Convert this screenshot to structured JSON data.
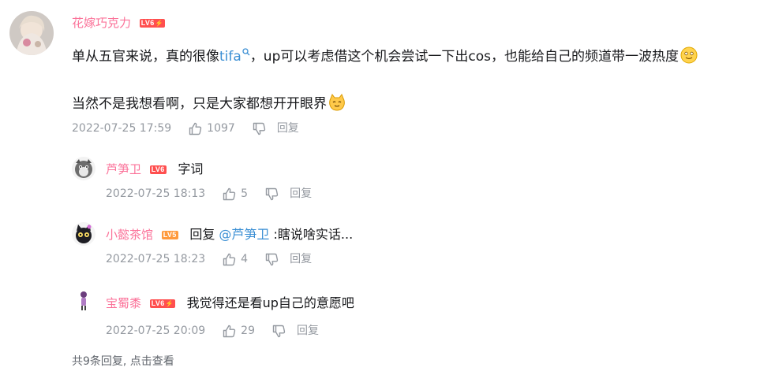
{
  "main_comment": {
    "username": "花嫁巧克力",
    "level": "LV6",
    "username_color": "#fb7299",
    "text_before_link": "单从五官来说，真的很像",
    "link_text": "tifa",
    "text_after_link": "，up可以考虑借这个机会尝试一下出cos，也能给自己的频道带一波热度",
    "line2": "当然不是我想看啊，只是大家都想开开眼界",
    "time": "2022-07-25 17:59",
    "likes": "1097",
    "reply_label": "回复"
  },
  "replies": [
    {
      "username": "芦笋卫",
      "level": "LV6",
      "username_color": "#fb7299",
      "text": "字词",
      "time": "2022-07-25 18:13",
      "likes": "5",
      "reply_label": "回复"
    },
    {
      "username": "小懿茶馆",
      "level": "LV5",
      "username_color": "#fb7299",
      "reply_prefix": "回复 ",
      "mention": "@芦笋卫",
      "text": " :瞎说啥实话...",
      "time": "2022-07-25 18:23",
      "likes": "4",
      "reply_label": "回复"
    },
    {
      "username": "宝蜀黍",
      "level": "LV6",
      "username_color": "#fb7299",
      "text": "我觉得还是看up自己的意愿吧",
      "time": "2022-07-25 20:09",
      "likes": "29",
      "reply_label": "回复"
    }
  ],
  "footer": {
    "view_more": "共9条回复, 点击查看"
  },
  "colors": {
    "link": "#3b8fd4",
    "meta": "#9499a0",
    "lv6": "#ff4f4f",
    "lv5": "#ff9a3d"
  }
}
